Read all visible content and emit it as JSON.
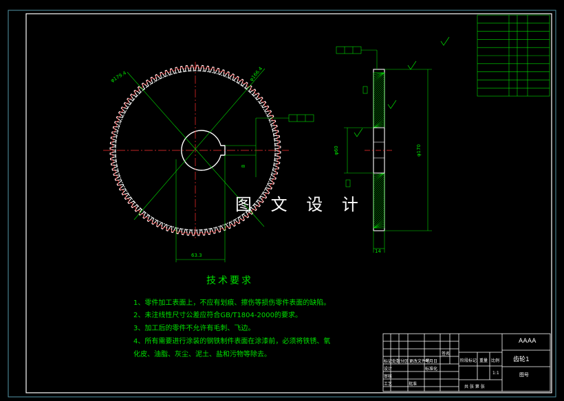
{
  "watermark": "图 文 设 计",
  "technical_requirements": {
    "title": "技术要求",
    "items": [
      "1、零件加工表面上，不应有划痕、擦伤等损伤零件表面的缺陷。",
      "2、未注线性尺寸公差应符合GB/T1804-2000的要求。",
      "3、加工后的零件不允许有毛刺、飞边。",
      "4、所有需要进行涂装的钢铁制件表面在涂漆前，必须将铁锈、氧",
      "   化皮、油脂、灰尘、泥土、盐和污物等除去。"
    ]
  },
  "title_block": {
    "company": "AAAA",
    "part_name": "齿轮1",
    "drawing_no_label": "图号",
    "labels": [
      "标记",
      "处数",
      "分区",
      "更改文件号",
      "签名",
      "年月日",
      "设计",
      "标准化",
      "审核",
      "工艺",
      "批准",
      "阶段标记",
      "重量",
      "比例",
      "共 张 第 张"
    ],
    "scale": "1:1"
  },
  "dimensions": {
    "tip_dia": "φ179.4",
    "root_dia": "φ166.4",
    "bore": "φ60",
    "keyway_width": "8",
    "keyway_depth": "63.3",
    "face_width": "14",
    "outer_dia": "φ170"
  },
  "param_table_rows": 10
}
